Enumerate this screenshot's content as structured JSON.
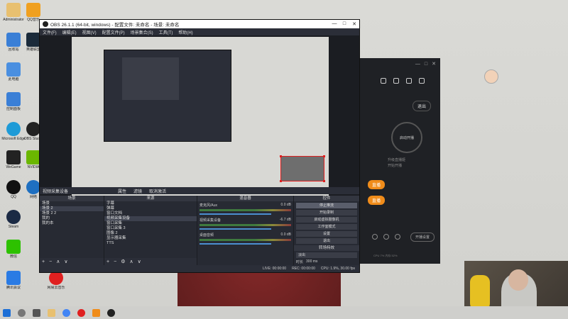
{
  "desktop": {
    "icons": [
      {
        "label": "Administrator"
      },
      {
        "label": "QQ音乐"
      },
      {
        "label": "Microsoft Edge"
      },
      {
        "label": "回收站"
      },
      {
        "label": "此电脑"
      },
      {
        "label": "英雄联盟"
      },
      {
        "label": "控制面板"
      },
      {
        "label": "WeGame"
      },
      {
        "label": "网络"
      },
      {
        "label": "OBS Studio"
      },
      {
        "label": "QQ"
      },
      {
        "label": "NVIDIA"
      },
      {
        "label": "Steam"
      },
      {
        "label": "微信"
      },
      {
        "label": "腾讯会议"
      },
      {
        "label": "网易云音乐"
      }
    ]
  },
  "obs": {
    "title": "OBS 26.1.1 (64-bit, windows) - 配置文件: 未命名 - 场景: 未命名",
    "menu": [
      "文件(F)",
      "编辑(E)",
      "视图(V)",
      "配置文件(P)",
      "场景集合(S)",
      "工具(T)",
      "帮助(H)"
    ],
    "source_bar": {
      "name": "视频采集设备",
      "properties": "属性",
      "filters": "滤镜",
      "deactivate": "取消激活"
    },
    "scenes": {
      "header": "场景",
      "items": [
        "场景",
        "场景 2",
        "场景 2 2",
        "我的",
        "我的本"
      ]
    },
    "sources": {
      "header": "来源",
      "items": [
        "字幕",
        "弹幕",
        "窗口文档",
        "视频采集设备",
        "窗口采集",
        "窗口采集 3",
        "图像 2",
        "显示器采集",
        "TTS"
      ]
    },
    "mixer": {
      "header": "混音器",
      "channels": [
        {
          "name": "麦克风/Aux",
          "db": "0.0 dB"
        },
        {
          "name": "视频采集设备",
          "db": "-6.7 dB"
        },
        {
          "name": "桌面音频",
          "db": "0.0 dB"
        }
      ]
    },
    "controls": {
      "header": "控件",
      "buttons": [
        "停止推流",
        "开始录制",
        "启动虚拟摄像机",
        "工作室模式",
        "设置",
        "退出"
      ]
    },
    "transition": {
      "header": "转场特效",
      "type": "淡出",
      "duration_label": "时长",
      "duration": "300 ms"
    },
    "status": {
      "live": "LIVE: 00:00:00",
      "rec": "REC: 00:00:00",
      "cpu": "CPU: 1.9%, 30.00 fps"
    }
  },
  "stream_app": {
    "exit_label": "退出",
    "circle_label": "启动开播",
    "sub1": "升级直播姬",
    "sub2": "开始开播",
    "btn1": "直播",
    "btn2": "直播",
    "pill": "开播设置",
    "foot": "CPU 7%  内存 52%"
  },
  "colors": {
    "obs_bg": "#2b2e38",
    "accent_orange": "#f08c1a",
    "selection_red": "#e02020",
    "taskbar": "#cfcfcc"
  }
}
